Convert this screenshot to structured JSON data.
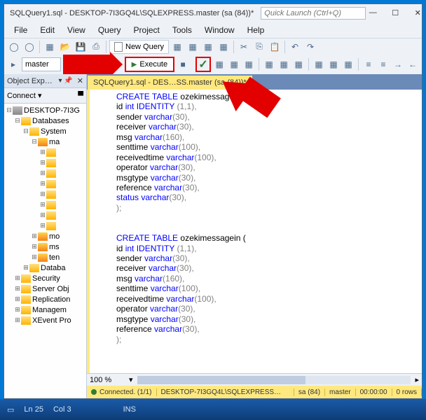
{
  "titlebar": {
    "title": "SQLQuery1.sql - DESKTOP-7I3GQ4L\\SQLEXPRESS.master (sa (84))*",
    "quicklaunch_placeholder": "Quick Launch (Ctrl+Q)"
  },
  "menubar": [
    "File",
    "Edit",
    "View",
    "Query",
    "Project",
    "Tools",
    "Window",
    "Help"
  ],
  "toolbar": {
    "newquery": "New Query"
  },
  "toolbar2": {
    "dbselect": "master",
    "execute": "Execute"
  },
  "objexp": {
    "title": "Object Exp…",
    "connect": "Connect ▾",
    "tree": {
      "server": "DESKTOP-7I3G",
      "databases": "Databases",
      "system": "System",
      "ma": "ma",
      "folders_l6": [
        "",
        "",
        "",
        ""
      ],
      "mo": "mo",
      "ms": "ms",
      "ten": "ten",
      "databa": "Databa",
      "security": "Security",
      "serverobj": "Server Obj",
      "replication": "Replication",
      "managem": "Managem",
      "xevent": "XEvent Pro"
    }
  },
  "filetab": "SQLQuery1.sql - DES…SS.master (sa (84))*",
  "code": {
    "l1a": "CREATE",
    "l1b": "TABLE",
    "l1c": "ozekimessageout",
    "l2a": "id",
    "l2b": "int",
    "l2c": "IDENTITY",
    "l2d": "(1,1),",
    "l3a": "sender",
    "l3b": "varchar",
    "l3c": "(30),",
    "l4a": "receiver",
    "l4b": "varchar",
    "l4c": "(30),",
    "l5a": "msg",
    "l5b": "varchar",
    "l5c": "(160),",
    "l6a": "senttime",
    "l6b": "varchar",
    "l6c": "(100),",
    "l7a": "receivedtime",
    "l7b": "varchar",
    "l7c": "(100),",
    "l8a": "operator",
    "l8b": "varchar",
    "l8c": "(30),",
    "l9a": "msgtype",
    "l9b": "varchar",
    "l9c": "(30),",
    "l10a": "reference",
    "l10b": "varchar",
    "l10c": "(30),",
    "l11a": "status",
    "l11b": "varchar",
    "l11c": "(30),",
    "l12": ");",
    "l14a": "CREATE",
    "l14b": "TABLE",
    "l14c": "ozekimessagein (",
    "l15a": "id",
    "l15b": "int",
    "l15c": "IDENTITY",
    "l15d": "(1,1),",
    "l16a": "sender",
    "l16b": "varchar",
    "l16c": "(30),",
    "l17a": "receiver",
    "l17b": "varchar",
    "l17c": "(30),",
    "l18a": "msg",
    "l18b": "varchar",
    "l18c": "(160),",
    "l19a": "senttime",
    "l19b": "varchar",
    "l19c": "(100),",
    "l20a": "receivedtime",
    "l20b": "varchar",
    "l20c": "(100),",
    "l21a": "operator",
    "l21b": "varchar",
    "l21c": "(30),",
    "l22a": "msgtype",
    "l22b": "varchar",
    "l22c": "(30),",
    "l23a": "reference",
    "l23b": "varchar",
    "l23c": "(30),",
    "l24": ");"
  },
  "zoom": "100 %",
  "status": {
    "connected": "Connected. (1/1)",
    "server": "DESKTOP-7I3GQ4L\\SQLEXPRESS…",
    "user": "sa (84)",
    "db": "master",
    "time": "00:00:00",
    "rows": "0 rows"
  },
  "taskbar": {
    "line": "Ln 25",
    "col": "Col 3",
    "ins": "INS"
  }
}
